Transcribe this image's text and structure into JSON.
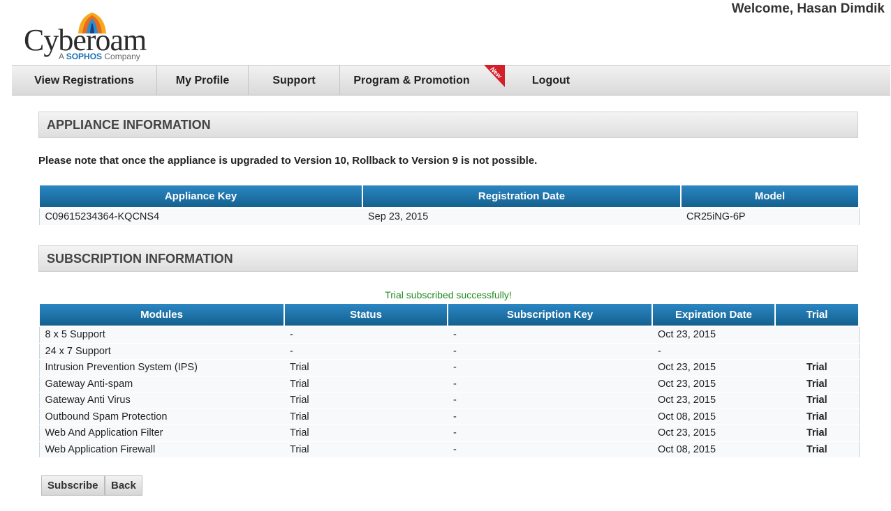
{
  "brand": {
    "name": "Cyberoam",
    "tagline_prefix": "A",
    "tagline_brand": "SOPHOS",
    "tagline_suffix": "Company"
  },
  "welcome": "Welcome, Hasan Dimdik",
  "nav": {
    "items": [
      {
        "label": "View Registrations"
      },
      {
        "label": "My Profile"
      },
      {
        "label": "Support"
      },
      {
        "label": "Program & Promotion"
      },
      {
        "label": "Logout"
      }
    ],
    "new_badge": "New"
  },
  "appliance": {
    "heading": "APPLIANCE INFORMATION",
    "note": "Please note that once the appliance is upgraded to Version 10, Rollback to Version 9 is not possible.",
    "columns": [
      "Appliance Key",
      "Registration Date",
      "Model"
    ],
    "row": [
      "C09615234364-KQCNS4",
      "Sep 23, 2015",
      "CR25iNG-6P"
    ]
  },
  "subscription": {
    "heading": "SUBSCRIPTION INFORMATION",
    "message": "Trial subscribed successfully!",
    "columns": [
      "Modules",
      "Status",
      "Subscription Key",
      "Expiration Date",
      "Trial"
    ],
    "rows": [
      {
        "module": "8 x 5 Support",
        "status": "-",
        "key": "-",
        "expiry": "Oct 23, 2015",
        "trial": ""
      },
      {
        "module": "24 x 7 Support",
        "status": "-",
        "key": "-",
        "expiry": "-",
        "trial": ""
      },
      {
        "module": "Intrusion Prevention System (IPS)",
        "status": "Trial",
        "key": "-",
        "expiry": "Oct 23, 2015",
        "trial": "Trial"
      },
      {
        "module": "Gateway Anti-spam",
        "status": "Trial",
        "key": "-",
        "expiry": "Oct 23, 2015",
        "trial": "Trial"
      },
      {
        "module": "Gateway Anti Virus",
        "status": "Trial",
        "key": "-",
        "expiry": "Oct 23, 2015",
        "trial": "Trial"
      },
      {
        "module": "Outbound Spam Protection",
        "status": "Trial",
        "key": "-",
        "expiry": "Oct 08, 2015",
        "trial": "Trial"
      },
      {
        "module": "Web And Application Filter",
        "status": "Trial",
        "key": "-",
        "expiry": "Oct 23, 2015",
        "trial": "Trial"
      },
      {
        "module": "Web Application Firewall",
        "status": "Trial",
        "key": "-",
        "expiry": "Oct 08, 2015",
        "trial": "Trial"
      }
    ]
  },
  "buttons": {
    "subscribe": "Subscribe",
    "back": "Back"
  },
  "colors": {
    "header_blue": "#1a6fa8",
    "success_green": "#1f8a1f",
    "link_blue": "#176fa5",
    "ribbon_red": "#d21f2a"
  }
}
